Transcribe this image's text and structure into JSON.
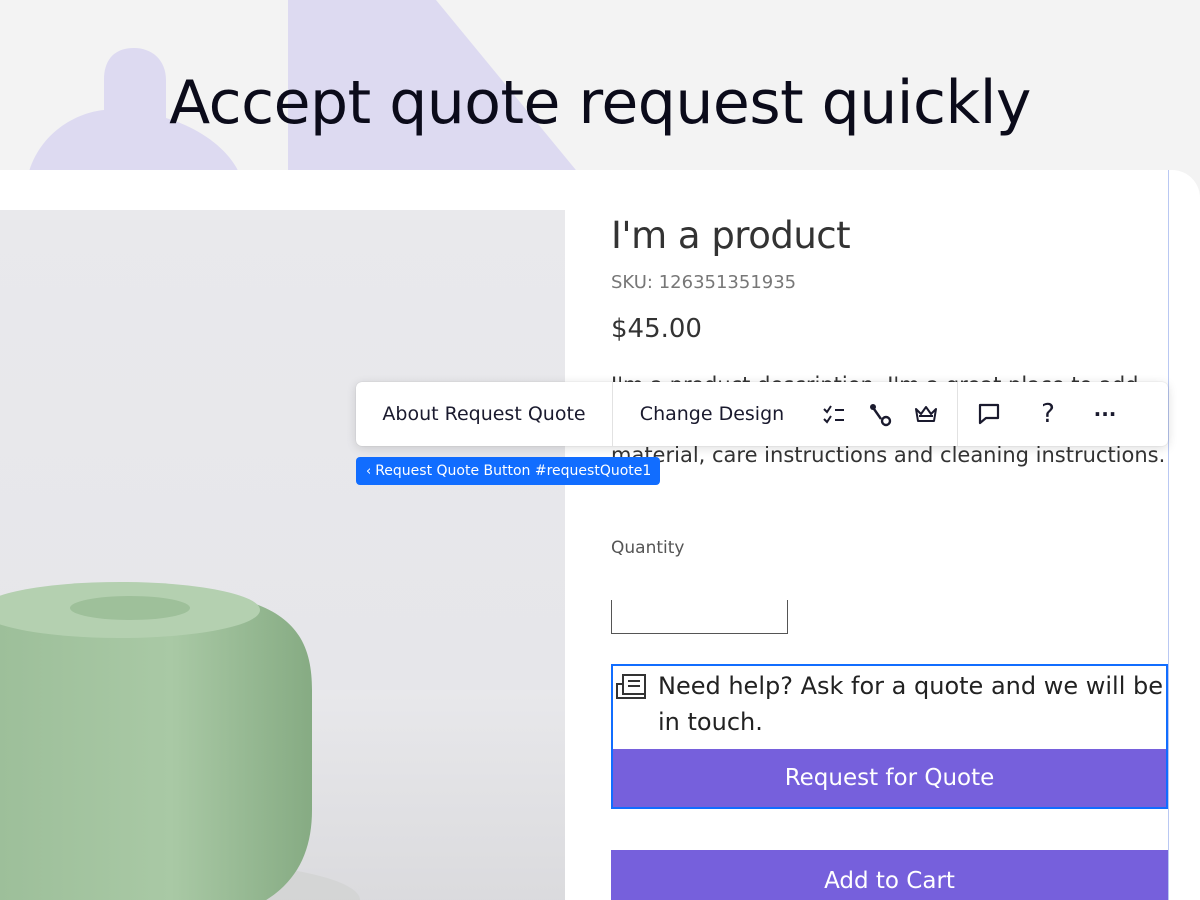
{
  "headline": "Accept quote request quickly",
  "colors": {
    "accent_purple": "#7660dc",
    "selection_blue": "#116dff",
    "lavender_shape": "#dddaf1",
    "product_green": "#9fc29c"
  },
  "product": {
    "title": "I'm a product",
    "sku": "SKU: 126351351935",
    "price": "$45.00",
    "description": "I'm a product description. I'm a great place to add more details about your product such as sizing, material, care instructions and cleaning instructions.",
    "quantity_label": "Quantity"
  },
  "toolbar": {
    "about_label": "About Request Quote",
    "change_design_label": "Change Design",
    "icons": [
      "settings-checklist-icon",
      "connect-icon",
      "premium-crown-icon",
      "comment-icon",
      "help-icon",
      "more-icon"
    ],
    "help_glyph": "?",
    "more_glyph": "···"
  },
  "selection": {
    "chevron": "‹",
    "tag_label": "Request Quote Button #requestQuote1"
  },
  "request_quote": {
    "icon": "quote-request-icon",
    "help_text": "Need help? Ask for a quote and we will be in touch.",
    "button_label": "Request for Quote"
  },
  "cart": {
    "button_label": "Add to Cart"
  }
}
